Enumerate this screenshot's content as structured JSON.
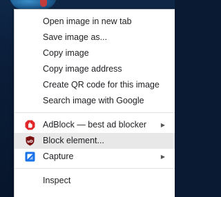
{
  "menu": {
    "group1": [
      {
        "label": "Open image in new tab"
      },
      {
        "label": "Save image as..."
      },
      {
        "label": "Copy image"
      },
      {
        "label": "Copy image address"
      },
      {
        "label": "Create QR code for this image"
      },
      {
        "label": "Search image with Google"
      }
    ],
    "group2": [
      {
        "label": "AdBlock — best ad blocker",
        "icon": "adblock-icon",
        "submenu_arrow": "▶"
      },
      {
        "label": "Block element...",
        "icon": "ublock-origin-icon"
      },
      {
        "label": "Capture",
        "icon": "capture-icon",
        "submenu_arrow": "▶"
      }
    ],
    "group3": [
      {
        "label": "Inspect"
      }
    ]
  },
  "colors": {
    "adblock_red": "#e0282b",
    "ublock_dark_red": "#7b1113",
    "capture_blue": "#1a73e8"
  }
}
